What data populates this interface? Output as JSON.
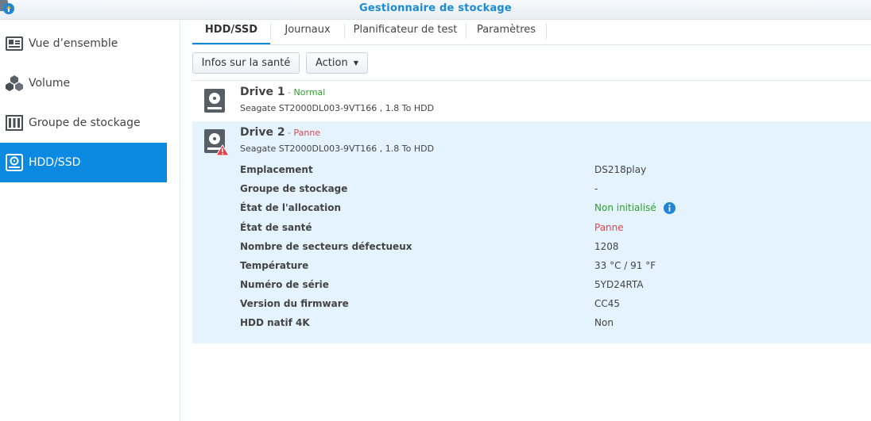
{
  "window": {
    "title": "Gestionnaire de stockage"
  },
  "sidebar": {
    "items": [
      {
        "label": "Vue d’ensemble",
        "icon": "overview-icon"
      },
      {
        "label": "Volume",
        "icon": "cubes-icon"
      },
      {
        "label": "Groupe de stockage",
        "icon": "storage-pool-icon"
      },
      {
        "label": "HDD/SSD",
        "icon": "hdd-icon",
        "active": true
      }
    ]
  },
  "tabs": [
    {
      "label": "HDD/SSD",
      "active": true
    },
    {
      "label": "Journaux"
    },
    {
      "label": "Planificateur de test"
    },
    {
      "label": "Paramètres"
    }
  ],
  "toolbar": {
    "health_info_label": "Infos sur la santé",
    "action_label": "Action"
  },
  "drives": [
    {
      "name": "Drive 1",
      "separator": " - ",
      "status": "Normal",
      "model": "Seagate ST2000DL003-9VT166 , 1.8 To HDD"
    },
    {
      "name": "Drive 2",
      "separator": " - ",
      "status": "Panne",
      "model": "Seagate ST2000DL003-9VT166 , 1.8 To HDD",
      "details": [
        {
          "label": "Emplacement",
          "value": "DS218play"
        },
        {
          "label": "Groupe de stockage",
          "value": "-"
        },
        {
          "label": "État de l'allocation",
          "value": "Non initialisé"
        },
        {
          "label": "État de santé",
          "value": "Panne"
        },
        {
          "label": "Nombre de secteurs défectueux",
          "value": "1208"
        },
        {
          "label": "Température",
          "value": "33 °C / 91 °F"
        },
        {
          "label": "Numéro de série",
          "value": "5YD24RTA"
        },
        {
          "label": "Version du firmware",
          "value": "CC45"
        },
        {
          "label": "HDD natif 4K",
          "value": "Non"
        }
      ]
    }
  ],
  "colors": {
    "accent": "#0c8ae2",
    "title": "#1a8ad4",
    "normal": "#33a032",
    "fail": "#e0454b",
    "selected_row": "#e4f3fd"
  }
}
